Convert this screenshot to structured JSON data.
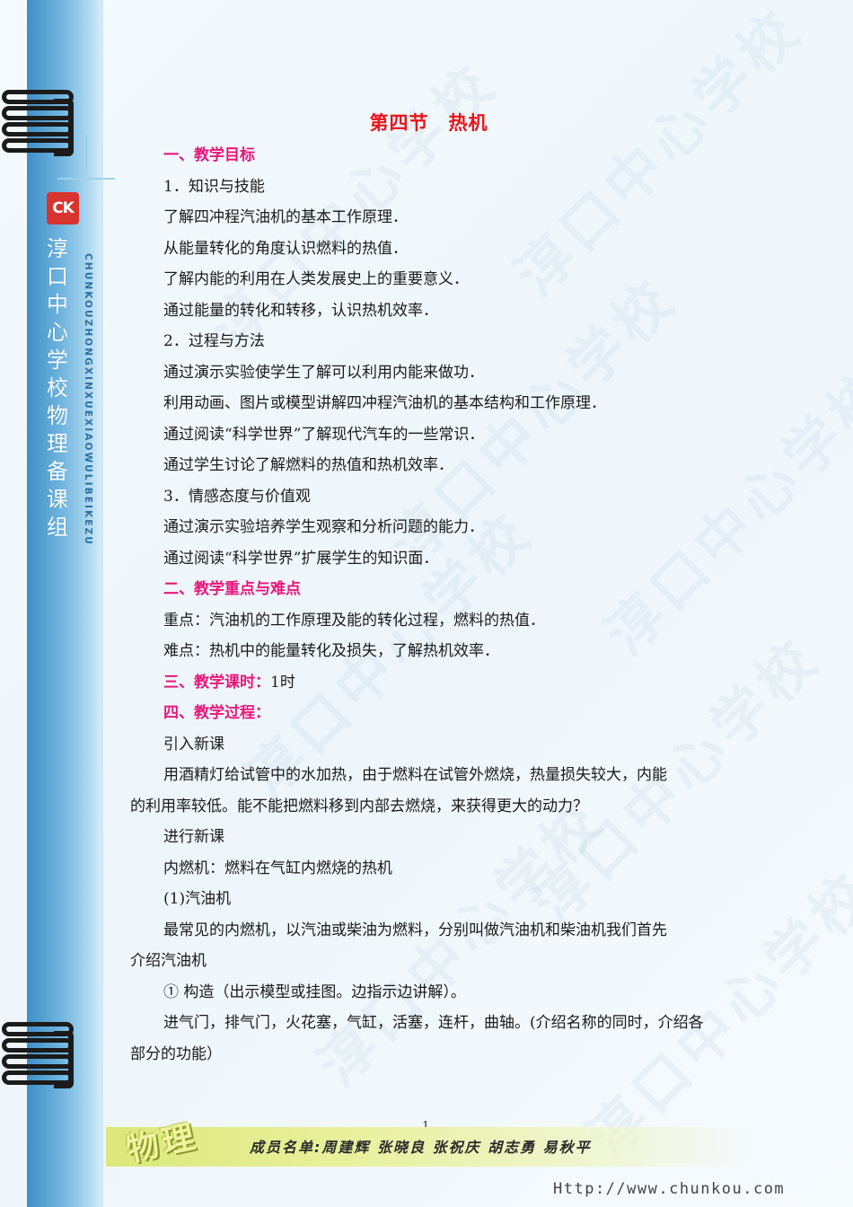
{
  "title": "第四节　热机",
  "watermark_text": "淳口中心学校",
  "sidebar": {
    "logo": "CK",
    "school_name_vertical": "淳口中心学校物理备课组",
    "school_pinyin": "CHUNKOUZHONGXINXUEXIAOWULIBEIKEZU"
  },
  "body": {
    "h1": "一、教学目标",
    "s1": "1．知识与技能",
    "s1_l1": "了解四冲程汽油机的基本工作原理．",
    "s1_l2": "从能量转化的角度认识燃料的热值．",
    "s1_l3": "了解内能的利用在人类发展史上的重要意义．",
    "s1_l4": "通过能量的转化和转移，认识热机效率．",
    "s2": "2．过程与方法",
    "s2_l1": "通过演示实验使学生了解可以利用内能来做功．",
    "s2_l2": "利用动画、图片或模型讲解四冲程汽油机的基本结构和工作原理．",
    "s2_l3": "通过阅读“科学世界”了解现代汽车的一些常识．",
    "s2_l4": "通过学生讨论了解燃料的热值和热机效率．",
    "s3": "3．情感态度与价值观",
    "s3_l1": "通过演示实验培养学生观察和分析问题的能力．",
    "s3_l2": "通过阅读“科学世界”扩展学生的知识面．",
    "h2": "二、教学重点与难点",
    "key_point": "重点：汽油机的工作原理及能的转化过程，燃料的热值．",
    "difficult_point": "难点：热机中的能量转化及损失，了解热机效率．",
    "h3": "三、教学课时：",
    "h3_value": "1时",
    "h4": "四、教学过程：",
    "intro": "引入新课",
    "intro_p1a": "用酒精灯给试管中的水加热，由于燃料在试管外燃烧，热量损失较大，内能",
    "intro_p1b": "的利用率较低。能不能把燃料移到内部去燃烧，来获得更大的动力？",
    "newlesson": "进行新课",
    "ice": "内燃机：燃料在气缸内燃烧的热机",
    "gas": "(1)汽油机",
    "gas_p1a": "最常见的内燃机，以汽油或柴油为燃料，分别叫做汽油机和柴油机我们首先",
    "gas_p1b": "介绍汽油机",
    "struct": "① 构造（出示模型或挂图。边指示边讲解）。",
    "parts_a": "进气门，排气门，火花塞，气缸，活塞，连杆，曲轴。(介绍名称的同时，介绍各",
    "parts_b": "部分的功能）"
  },
  "footer": {
    "page_number": "1",
    "subject": "物理",
    "members": "成员名单:周建辉 张晓良 张祝庆 胡志勇 易秋平",
    "url": "Http://www.chunkou.com"
  },
  "colors": {
    "title": "#e8141b",
    "heading": "#e8177a",
    "strip": "#5aa6d6"
  }
}
